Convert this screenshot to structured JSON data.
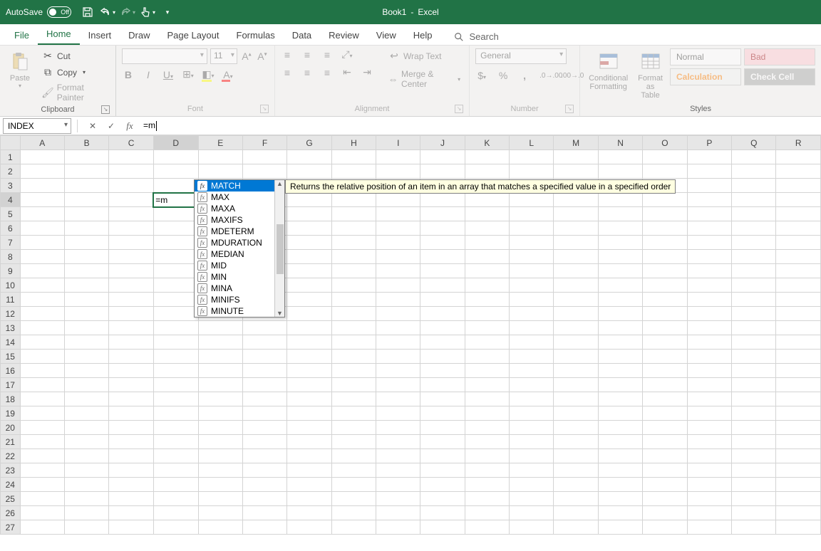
{
  "titlebar": {
    "autosave_label": "AutoSave",
    "autosave_state": "Off",
    "doc_name": "Book1",
    "app_name": "Excel"
  },
  "tabs": {
    "file": "File",
    "home": "Home",
    "insert": "Insert",
    "draw": "Draw",
    "page_layout": "Page Layout",
    "formulas": "Formulas",
    "data": "Data",
    "review": "Review",
    "view": "View",
    "help": "Help",
    "search": "Search"
  },
  "ribbon": {
    "clipboard": {
      "label": "Clipboard",
      "paste": "Paste",
      "cut": "Cut",
      "copy": "Copy",
      "format_painter": "Format Painter"
    },
    "font": {
      "label": "Font",
      "size": "11"
    },
    "alignment": {
      "label": "Alignment",
      "wrap": "Wrap Text",
      "merge": "Merge & Center"
    },
    "number": {
      "label": "Number",
      "format": "General"
    },
    "styles": {
      "label": "Styles",
      "conditional": "Conditional\nFormatting",
      "format_table": "Format as\nTable",
      "normal": "Normal",
      "bad": "Bad",
      "calculation": "Calculation",
      "check_cell": "Check Cell"
    }
  },
  "formula_bar": {
    "name_box": "INDEX",
    "formula": "=m"
  },
  "grid": {
    "columns": [
      "A",
      "B",
      "C",
      "D",
      "E",
      "F",
      "G",
      "H",
      "I",
      "J",
      "K",
      "L",
      "M",
      "N",
      "O",
      "P",
      "Q",
      "R"
    ],
    "rows": 27,
    "active_cell_value": "=m",
    "active_col_index": 3,
    "active_row_index": 3
  },
  "autocomplete": {
    "items": [
      "MATCH",
      "MAX",
      "MAXA",
      "MAXIFS",
      "MDETERM",
      "MDURATION",
      "MEDIAN",
      "MID",
      "MIN",
      "MINA",
      "MINIFS",
      "MINUTE"
    ],
    "selected_index": 0,
    "tooltip": "Returns the relative position of an item in an array that matches a specified value in a specified order"
  }
}
